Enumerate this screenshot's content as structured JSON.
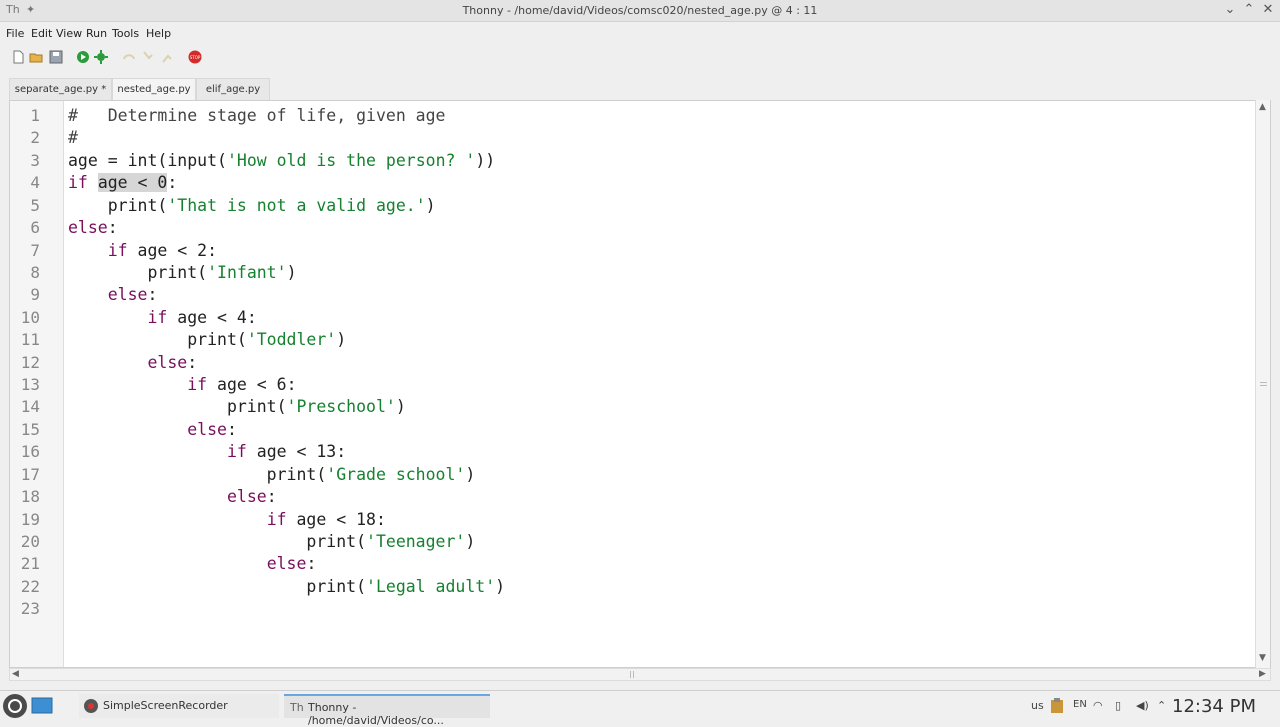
{
  "window": {
    "title": "Thonny  -  /home/david/Videos/comsc020/nested_age.py  @  4 : 11"
  },
  "menu": [
    "File",
    "Edit",
    "View",
    "Run",
    "Tools",
    "Help"
  ],
  "toolbar": {
    "items": [
      "new-file",
      "open-file",
      "save-file",
      "run",
      "debug",
      "step-over",
      "step-into",
      "step-out",
      "stop"
    ],
    "stop_label": "STOP"
  },
  "tabs": [
    {
      "label": "separate_age.py *",
      "active": false
    },
    {
      "label": "nested_age.py",
      "active": true
    },
    {
      "label": "elif_age.py",
      "active": false
    }
  ],
  "editor": {
    "lines": [
      "#   Determine stage of life, given age",
      "#",
      "age = int(input('How old is the person? '))",
      "if age < 0:",
      "    print('That is not a valid age.')",
      "else:",
      "    if age < 2:",
      "        print('Infant')",
      "    else:",
      "        if age < 4:",
      "            print('Toddler')",
      "        else:",
      "            if age < 6:",
      "                print('Preschool')",
      "            else:",
      "                if age < 13:",
      "                    print('Grade school')",
      "                else:",
      "                    if age < 18:",
      "                        print('Teenager')",
      "                    else:",
      "                        print('Legal adult')",
      ""
    ],
    "line_numbers": [
      "1",
      "2",
      "3",
      "4",
      "5",
      "6",
      "7",
      "8",
      "9",
      "10",
      "11",
      "12",
      "13",
      "14",
      "15",
      "16",
      "17",
      "18",
      "19",
      "20",
      "21",
      "22",
      "23"
    ],
    "selection": {
      "line": 4,
      "text": "age < 0"
    }
  },
  "taskbar": {
    "tasks": [
      "SimpleScreenRecorder",
      "Thonny  -  /home/david/Videos/co..."
    ],
    "keyboard": "us",
    "lang": "EN",
    "clock": "12:34 PM"
  },
  "colors": {
    "keyword": "#7a0f5c",
    "string": "#16812f",
    "selection": "#d6d6d6"
  }
}
